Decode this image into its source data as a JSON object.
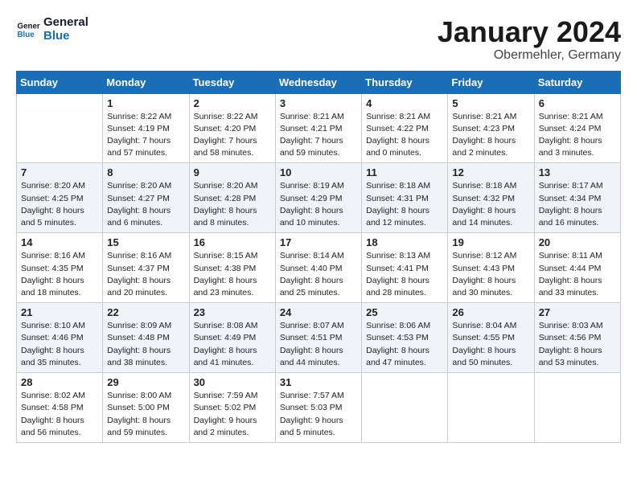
{
  "logo": {
    "line1": "General",
    "line2": "Blue"
  },
  "title": "January 2024",
  "subtitle": "Obermehler, Germany",
  "days_header": [
    "Sunday",
    "Monday",
    "Tuesday",
    "Wednesday",
    "Thursday",
    "Friday",
    "Saturday"
  ],
  "weeks": [
    [
      {
        "day": "",
        "info": ""
      },
      {
        "day": "1",
        "info": "Sunrise: 8:22 AM\nSunset: 4:19 PM\nDaylight: 7 hours\nand 57 minutes."
      },
      {
        "day": "2",
        "info": "Sunrise: 8:22 AM\nSunset: 4:20 PM\nDaylight: 7 hours\nand 58 minutes."
      },
      {
        "day": "3",
        "info": "Sunrise: 8:21 AM\nSunset: 4:21 PM\nDaylight: 7 hours\nand 59 minutes."
      },
      {
        "day": "4",
        "info": "Sunrise: 8:21 AM\nSunset: 4:22 PM\nDaylight: 8 hours\nand 0 minutes."
      },
      {
        "day": "5",
        "info": "Sunrise: 8:21 AM\nSunset: 4:23 PM\nDaylight: 8 hours\nand 2 minutes."
      },
      {
        "day": "6",
        "info": "Sunrise: 8:21 AM\nSunset: 4:24 PM\nDaylight: 8 hours\nand 3 minutes."
      }
    ],
    [
      {
        "day": "7",
        "info": "Sunrise: 8:20 AM\nSunset: 4:25 PM\nDaylight: 8 hours\nand 5 minutes."
      },
      {
        "day": "8",
        "info": "Sunrise: 8:20 AM\nSunset: 4:27 PM\nDaylight: 8 hours\nand 6 minutes."
      },
      {
        "day": "9",
        "info": "Sunrise: 8:20 AM\nSunset: 4:28 PM\nDaylight: 8 hours\nand 8 minutes."
      },
      {
        "day": "10",
        "info": "Sunrise: 8:19 AM\nSunset: 4:29 PM\nDaylight: 8 hours\nand 10 minutes."
      },
      {
        "day": "11",
        "info": "Sunrise: 8:18 AM\nSunset: 4:31 PM\nDaylight: 8 hours\nand 12 minutes."
      },
      {
        "day": "12",
        "info": "Sunrise: 8:18 AM\nSunset: 4:32 PM\nDaylight: 8 hours\nand 14 minutes."
      },
      {
        "day": "13",
        "info": "Sunrise: 8:17 AM\nSunset: 4:34 PM\nDaylight: 8 hours\nand 16 minutes."
      }
    ],
    [
      {
        "day": "14",
        "info": "Sunrise: 8:16 AM\nSunset: 4:35 PM\nDaylight: 8 hours\nand 18 minutes."
      },
      {
        "day": "15",
        "info": "Sunrise: 8:16 AM\nSunset: 4:37 PM\nDaylight: 8 hours\nand 20 minutes."
      },
      {
        "day": "16",
        "info": "Sunrise: 8:15 AM\nSunset: 4:38 PM\nDaylight: 8 hours\nand 23 minutes."
      },
      {
        "day": "17",
        "info": "Sunrise: 8:14 AM\nSunset: 4:40 PM\nDaylight: 8 hours\nand 25 minutes."
      },
      {
        "day": "18",
        "info": "Sunrise: 8:13 AM\nSunset: 4:41 PM\nDaylight: 8 hours\nand 28 minutes."
      },
      {
        "day": "19",
        "info": "Sunrise: 8:12 AM\nSunset: 4:43 PM\nDaylight: 8 hours\nand 30 minutes."
      },
      {
        "day": "20",
        "info": "Sunrise: 8:11 AM\nSunset: 4:44 PM\nDaylight: 8 hours\nand 33 minutes."
      }
    ],
    [
      {
        "day": "21",
        "info": "Sunrise: 8:10 AM\nSunset: 4:46 PM\nDaylight: 8 hours\nand 35 minutes."
      },
      {
        "day": "22",
        "info": "Sunrise: 8:09 AM\nSunset: 4:48 PM\nDaylight: 8 hours\nand 38 minutes."
      },
      {
        "day": "23",
        "info": "Sunrise: 8:08 AM\nSunset: 4:49 PM\nDaylight: 8 hours\nand 41 minutes."
      },
      {
        "day": "24",
        "info": "Sunrise: 8:07 AM\nSunset: 4:51 PM\nDaylight: 8 hours\nand 44 minutes."
      },
      {
        "day": "25",
        "info": "Sunrise: 8:06 AM\nSunset: 4:53 PM\nDaylight: 8 hours\nand 47 minutes."
      },
      {
        "day": "26",
        "info": "Sunrise: 8:04 AM\nSunset: 4:55 PM\nDaylight: 8 hours\nand 50 minutes."
      },
      {
        "day": "27",
        "info": "Sunrise: 8:03 AM\nSunset: 4:56 PM\nDaylight: 8 hours\nand 53 minutes."
      }
    ],
    [
      {
        "day": "28",
        "info": "Sunrise: 8:02 AM\nSunset: 4:58 PM\nDaylight: 8 hours\nand 56 minutes."
      },
      {
        "day": "29",
        "info": "Sunrise: 8:00 AM\nSunset: 5:00 PM\nDaylight: 8 hours\nand 59 minutes."
      },
      {
        "day": "30",
        "info": "Sunrise: 7:59 AM\nSunset: 5:02 PM\nDaylight: 9 hours\nand 2 minutes."
      },
      {
        "day": "31",
        "info": "Sunrise: 7:57 AM\nSunset: 5:03 PM\nDaylight: 9 hours\nand 5 minutes."
      },
      {
        "day": "",
        "info": ""
      },
      {
        "day": "",
        "info": ""
      },
      {
        "day": "",
        "info": ""
      }
    ]
  ]
}
